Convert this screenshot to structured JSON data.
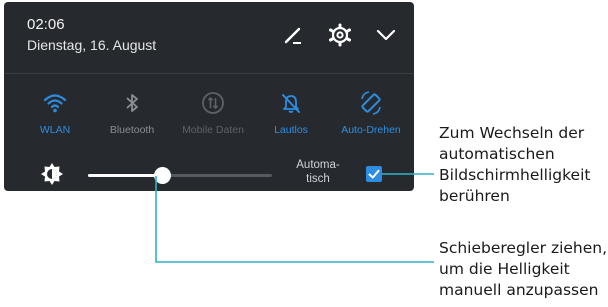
{
  "header": {
    "time": "02:06",
    "date": "Dienstag, 16. August"
  },
  "header_icons": [
    "edit-icon",
    "settings-gear-icon",
    "chevron-down-icon"
  ],
  "tiles": [
    {
      "label": "WLAN",
      "icon": "wifi-icon",
      "active": true
    },
    {
      "label": "Bluetooth",
      "icon": "bluetooth-icon",
      "active": false
    },
    {
      "label": "Mobile Daten",
      "icon": "mobile-data-icon",
      "active": false
    },
    {
      "label": "Lautlos",
      "icon": "silent-icon",
      "active": true
    },
    {
      "label": "Auto-Drehen",
      "icon": "auto-rotate-icon",
      "active": true
    }
  ],
  "brightness": {
    "icon": "brightness-icon",
    "level_fraction": 0.4,
    "auto_label_line1": "Automa-",
    "auto_label_line2": "tisch",
    "auto_checked": true
  },
  "colors": {
    "panel_bg": "#262a2f",
    "accent": "#2d8de0",
    "tile_inactive": "#5d6268",
    "leader_line": "#2fb3c8"
  },
  "callouts": {
    "auto_brightness": "Zum Wechseln der automatischen Bildschirmhelligkeit berühren",
    "slider": "Schieberegler ziehen, um die Helligkeit manuell anzupassen"
  }
}
